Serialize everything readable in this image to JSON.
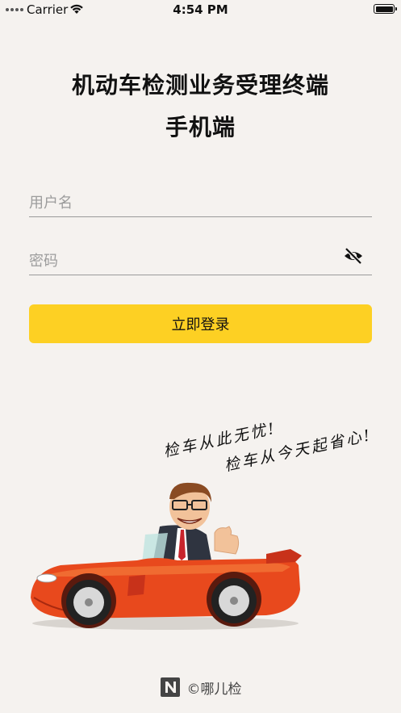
{
  "status_bar": {
    "carrier": "Carrier",
    "time": "4:54 PM",
    "icons": [
      "signal-dots-icon",
      "wifi-icon",
      "battery-icon"
    ]
  },
  "title": {
    "line1": "机动车检测业务受理终端",
    "line2": "手机端"
  },
  "form": {
    "username_placeholder": "用户名",
    "password_placeholder": "密码",
    "password_toggle_icon": "eye-slash-icon",
    "login_label": "立即登录"
  },
  "slogan": {
    "line1": "检车从此无忧!",
    "line2": "检车从今天起省心!"
  },
  "illustration_icon": "man-in-red-convertible-illustration",
  "footer": {
    "logo_icon": "n-logo-icon",
    "copyright": "©哪儿检"
  },
  "colors": {
    "background": "#f5f2ef",
    "button": "#fdd023",
    "car": "#e8491d"
  }
}
